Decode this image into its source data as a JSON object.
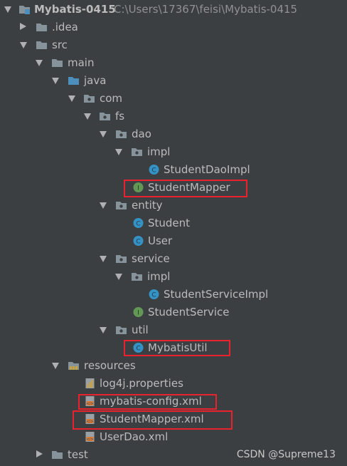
{
  "project": {
    "name": "Mybatis-0415",
    "path": "C:\\Users\\17367\\feisi\\Mybatis-0415"
  },
  "tree": {
    "idea": ".idea",
    "src": "src",
    "main": "main",
    "java": "java",
    "com": "com",
    "fs": "fs",
    "dao": "dao",
    "dao_impl": "impl",
    "student_dao_impl": "StudentDaoImpl",
    "student_mapper": "StudentMapper",
    "entity": "entity",
    "student": "Student",
    "user": "User",
    "service": "service",
    "service_impl": "impl",
    "student_service_impl": "StudentServiceImpl",
    "student_service": "StudentService",
    "util": "util",
    "mybatis_util": "MybatisUtil",
    "resources": "resources",
    "log4j": "log4j.properties",
    "mybatis_config": "mybatis-config.xml",
    "student_mapper_xml": "StudentMapper.xml",
    "user_dao_xml": "UserDao.xml",
    "test": "test"
  },
  "watermark": "CSDN @Supreme13",
  "colors": {
    "background": "#3c3f41",
    "highlight_box": "#e8232d",
    "class_icon": "#3592c4",
    "interface_icon": "#629755",
    "folder": "#87939a",
    "source_folder": "#4c8fbd",
    "xml_icon": "#d67c3a"
  }
}
